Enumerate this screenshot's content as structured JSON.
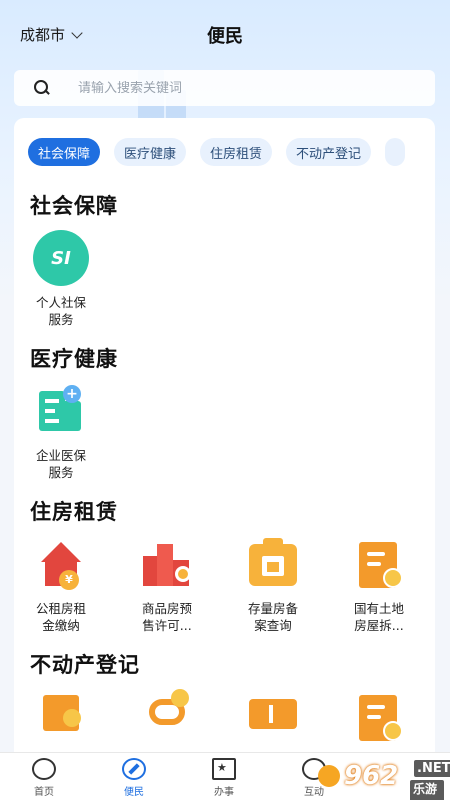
{
  "header": {
    "city": "成都市",
    "title": "便民"
  },
  "search": {
    "placeholder": "请输入搜索关键词"
  },
  "tabs": [
    {
      "label": "社会保障",
      "active": true
    },
    {
      "label": "医疗健康",
      "active": false
    },
    {
      "label": "住房租赁",
      "active": false
    },
    {
      "label": "不动产登记",
      "active": false
    }
  ],
  "sections": {
    "social": {
      "title": "社会保障",
      "items": [
        {
          "label_line1": "个人社保",
          "label_line2": "服务",
          "icon": "si-logo-icon",
          "icon_text": "SI"
        }
      ]
    },
    "medical": {
      "title": "医疗健康",
      "items": [
        {
          "label_line1": "企业医保",
          "label_line2": "服务",
          "icon": "hospital-building-icon"
        }
      ]
    },
    "housing": {
      "title": "住房租赁",
      "items": [
        {
          "label_line1": "公租房租",
          "label_line2": "金缴纳",
          "icon": "house-coin-icon"
        },
        {
          "label_line1": "商品房预",
          "label_line2": "售许可...",
          "icon": "buildings-search-icon"
        },
        {
          "label_line1": "存量房备",
          "label_line2": "案查询",
          "icon": "house-folder-icon"
        },
        {
          "label_line1": "国有土地",
          "label_line2": "房屋拆...",
          "icon": "document-download-icon"
        }
      ]
    },
    "realestate": {
      "title": "不动产登记",
      "items": [
        {
          "icon": "building-check-icon"
        },
        {
          "icon": "route-coin-icon"
        },
        {
          "icon": "ticket-icon"
        },
        {
          "icon": "document-check-icon"
        }
      ]
    }
  },
  "tabbar": [
    {
      "label": "首页",
      "icon": "home-panda-icon",
      "active": false
    },
    {
      "label": "便民",
      "icon": "compass-icon",
      "active": true
    },
    {
      "label": "办事",
      "icon": "bookmark-star-icon",
      "active": false
    },
    {
      "label": "互动",
      "icon": "chat-icon",
      "active": false
    }
  ],
  "watermark": {
    "brand": "962",
    "suffix": ".NET",
    "cn": "乐游网"
  },
  "colors": {
    "accent": "#1f6fe0",
    "teal": "#2ec8a8",
    "red": "#e2463e",
    "orange": "#f7b23b"
  }
}
